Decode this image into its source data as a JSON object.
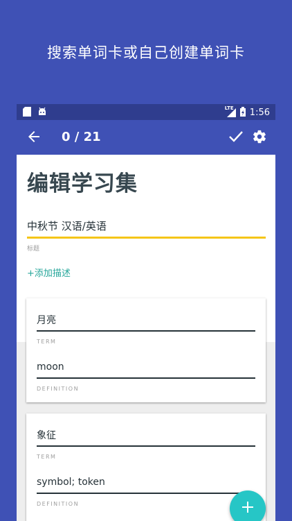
{
  "promo": {
    "text": "搜索单词卡或自己创建单词卡"
  },
  "statusbar": {
    "time": "1:56",
    "network": "LTE"
  },
  "toolbar": {
    "counter": "0 / 21"
  },
  "editor": {
    "heading": "编辑学习集",
    "title_value": "中秋节 汉语/英语",
    "title_label": "标题",
    "add_description": "+添加描述"
  },
  "cards": [
    {
      "term": "月亮",
      "term_label": "TERM",
      "definition": "moon",
      "definition_label": "DEFINITION"
    },
    {
      "term": "象征",
      "term_label": "TERM",
      "definition": "symbol; token",
      "definition_label": "DEFINITION"
    }
  ],
  "colors": {
    "primary": "#3f51b5",
    "accent_yellow": "#f5c518",
    "teal": "#26a69a",
    "fab": "#26c6c6"
  }
}
